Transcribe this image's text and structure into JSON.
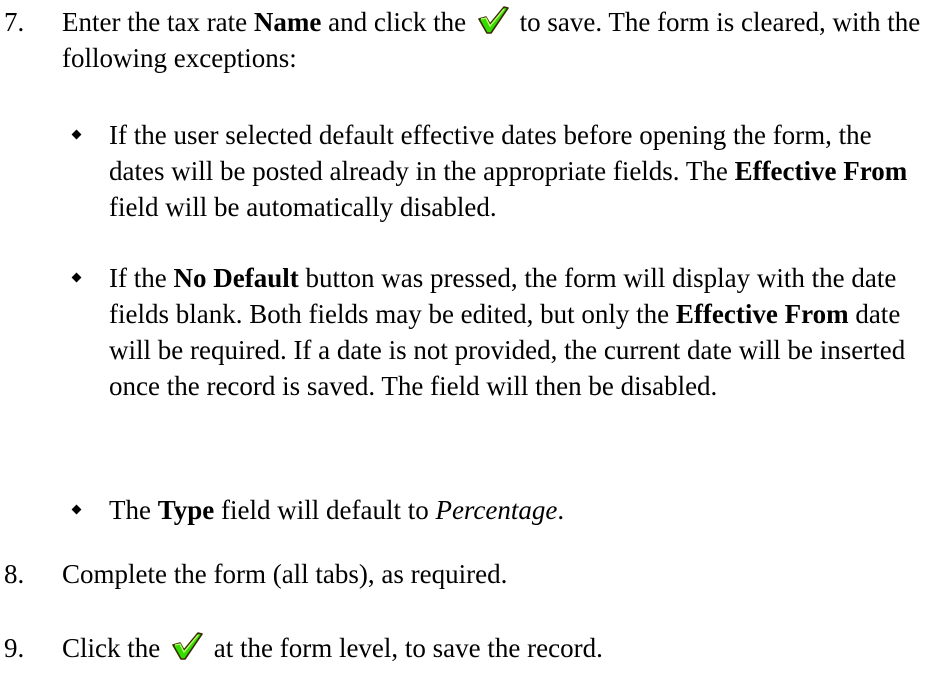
{
  "step7": {
    "number": "7.",
    "text_a": "Enter the tax rate ",
    "name_bold": "Name",
    "text_b": " and click the ",
    "text_c": " to save. The form is cleared, with the following exceptions:",
    "save_icon": "green-checkmark-icon"
  },
  "bullets": [
    {
      "a": "If the user selected default effective dates before opening the form, the dates will be posted already in the appropriate fields. The ",
      "bold": "Effective From",
      "b": " field will be automatically disabled."
    },
    {
      "a": "If the ",
      "bold1": "No Default",
      "b": " button was pressed, the form will display with the date fields blank. Both fields may be edited, but only the ",
      "bold2": "Effective From",
      "c": " date will be required. If a date is not provided, the current date will be inserted once the record is saved. The field will then be disabled."
    },
    {
      "a": "The ",
      "bold": "Type",
      "b": " field will default to ",
      "italic": "Percentage",
      "c": "."
    }
  ],
  "step8": {
    "number": "8.",
    "text": "Complete the form (all tabs), as required."
  },
  "step9": {
    "number": "9.",
    "text_a": "Click the ",
    "text_b": " at the form level, to save the record.",
    "save_icon": "green-checkmark-icon"
  },
  "colors": {
    "check_fill": "#33dd00",
    "check_outline": "#3a2a00"
  }
}
